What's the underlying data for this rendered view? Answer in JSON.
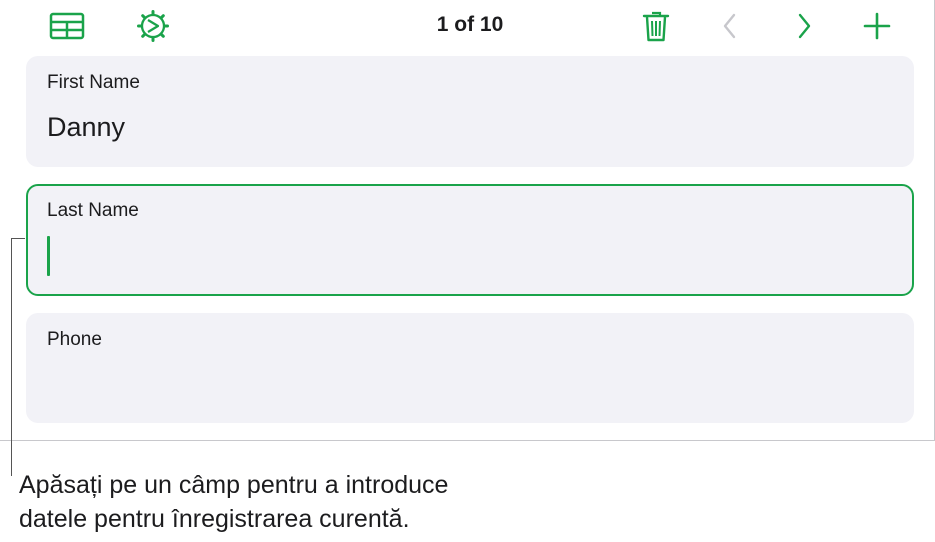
{
  "toolbar": {
    "record_counter": "1 of 10",
    "icons": {
      "table": "table-icon",
      "settings": "gear-icon",
      "delete": "trash-icon",
      "previous": "chevron-left-icon",
      "next": "chevron-right-icon",
      "add": "plus-icon"
    },
    "accent_color": "#1aa34a",
    "disabled_color": "#c7c7cc"
  },
  "form": {
    "fields": [
      {
        "label": "First Name",
        "value": "Danny"
      },
      {
        "label": "Last Name",
        "value": ""
      },
      {
        "label": "Phone",
        "value": ""
      }
    ]
  },
  "callout": {
    "text_line1": "Apăsați pe un câmp pentru a introduce",
    "text_line2": "datele pentru înregistrarea curentă."
  }
}
